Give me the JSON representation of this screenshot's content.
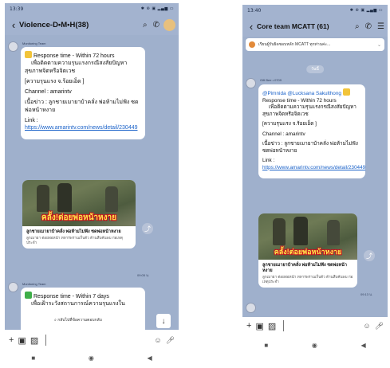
{
  "left": {
    "status_time": "13:39",
    "status_right": "✱ ⊛ ▣ ▂▄▆ ▭",
    "title": "Violence-D•M•H(38)",
    "sender": "Monitoring Team",
    "msg1": {
      "line1": "Response time - Within 72 hours",
      "line2": "เพื่อติดตามความรุนแรงกรณีสงสัยปัญหาสุขภาพจิตหรือจิตเวช",
      "severity": "[ความรุนแรง   จ.ร้อยเอ็ด  ]",
      "channel": "Channel  : amarintv",
      "news": "เนื้อข่าว : ลูกชายเมายาบ้าคลั่ง พ่อห้ามไม่ฟัง ซดพ่อหน้าหงาย",
      "link_label": "Link : ",
      "link": "https://www.amarintv.com/news/detail/230449"
    },
    "card": {
      "caption": "คลั้ง!ต่อยพ่อหน้าหงาย",
      "title": "ลูกชายเมายาบ้าคลั่ง พ่อห้ามไม่ฟัง ซดพ่อหน้าหงาย",
      "desc": "ลูกเมายา ต่อยพ่อหน้า ทหารพรานเก็บตัว ต้านสืบค้นพบ ก่อเหตุประจำ"
    },
    "card_time": "09:05 น.",
    "msg2": {
      "line1": "Response time - Within 7 days",
      "line2": "เพื่อเฝ้าระวังสถานการณ์ความรุนแรงใน"
    },
    "jump_label": "กลับไปที่ข้อความตอบกลับ"
  },
  "right": {
    "status_time": "13:40",
    "status_right": "✱ ⊛ ▣ ▂▄▆ ▭",
    "title": "Core team MCATT (61)",
    "notice": "เรียนผู้รับผิดชอบหลัก MCATT ทุกท่านค่ะ...",
    "date": "วันนี้",
    "sender": "Gift Bee • 0709",
    "msg": {
      "mention1": "@Pimnida",
      "mention2": "@Lucksana Sakulthong",
      "line1": "Response time - Within 72 hours",
      "line2": "เพื่อติดตามความรุนแรงกรณีสงสัยปัญหาสุขภาพจิตหรือจิตเวช",
      "severity": "[ความรุนแรง   จ.ร้อยเอ็ด  ]",
      "channel": "Channel  : amarintv",
      "news": "เนื้อข่าว : ลูกชายเมายาบ้าคลั่ง พ่อห้ามไม่ฟัง ซดพ่อหน้าหงาย",
      "link_label": "Link : ",
      "link": "https://www.amarintv.com/news/detail/230449"
    },
    "card": {
      "caption": "คลั้ง!ต่อยพ่อหน้าหงาย",
      "title": "ลูกชายเมายาบ้าคลั่ง พ่อห้ามไม่ฟัง ซดพ่อหน้าหงาย",
      "desc": "ลูกเมายา ต่อยพ่อหน้า ทหารพรานเก็บตัว ต้านสืบค้นพบ ก่อเหตุประจำ"
    },
    "card_time": "09:13 น."
  },
  "colors": {
    "chat_bg": "#9fb0cc",
    "link": "#1a62c9",
    "caption_yellow": "#ffe34a"
  }
}
